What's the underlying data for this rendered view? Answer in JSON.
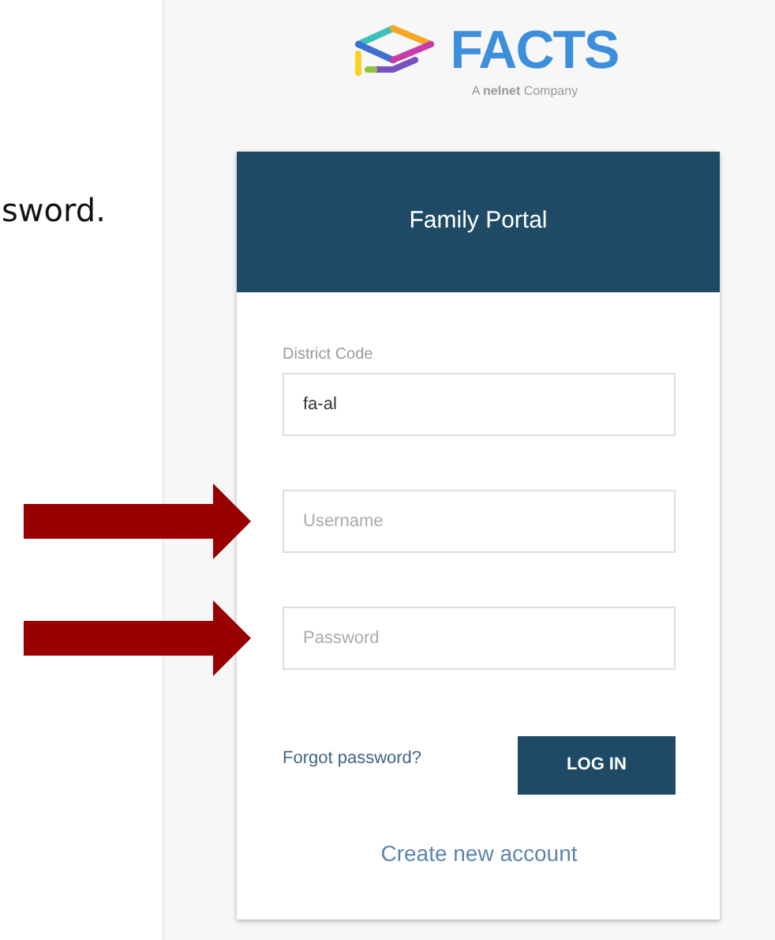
{
  "instruction_fragment": "sword.",
  "logo": {
    "wordmark": "FACTS",
    "tagline": "A **nelnet** Company"
  },
  "login_card": {
    "title": "Family Portal",
    "fields": [
      {
        "label": "District Code",
        "value": "fa-al"
      },
      {
        "placeholder": "Username",
        "arrow": true
      },
      {
        "placeholder": "Password",
        "arrow": true
      }
    ],
    "forgot_link": "Forgot password?",
    "login_button": "LOG IN",
    "create_account_link": "Create new account"
  }
}
